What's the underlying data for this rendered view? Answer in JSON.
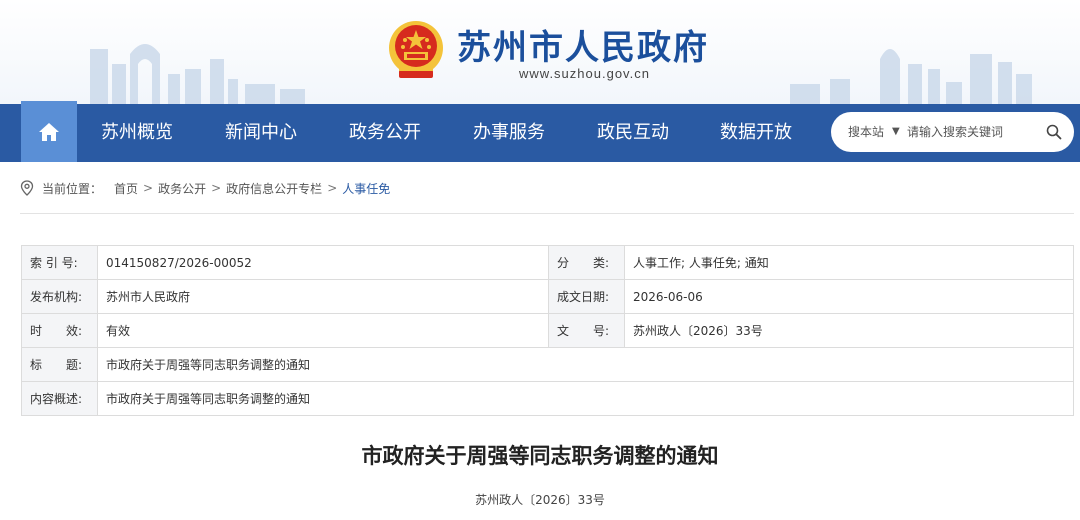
{
  "header": {
    "site_title": "苏州市人民政府",
    "site_url": "www.suzhou.gov.cn"
  },
  "nav": {
    "home_icon": "home-icon",
    "items": [
      {
        "label": "苏州概览"
      },
      {
        "label": "新闻中心"
      },
      {
        "label": "政务公开"
      },
      {
        "label": "办事服务"
      },
      {
        "label": "政民互动"
      },
      {
        "label": "数据开放"
      }
    ],
    "search": {
      "scope": "搜本站",
      "placeholder": "请输入搜索关键词"
    }
  },
  "breadcrumb": {
    "label": "当前位置：",
    "items": [
      "首页",
      "政务公开",
      "政府信息公开专栏",
      "人事任免"
    ],
    "separator": ">"
  },
  "info": {
    "index_label": "索 引 号:",
    "index_value": "014150827/2026-00052",
    "category_label": "分　　类:",
    "category_value": "人事工作;  人事任免;  通知",
    "publisher_label": "发布机构:",
    "publisher_value": "苏州市人民政府",
    "date_label": "成文日期:",
    "date_value": "2026-06-06",
    "validity_label": "时　　效:",
    "validity_value": "有效",
    "docno_label": "文　　号:",
    "docno_value": "苏州政人〔2026〕33号",
    "title_label": "标　　题:",
    "title_value": "市政府关于周强等同志职务调整的通知",
    "summary_label": "内容概述:",
    "summary_value": "市政府关于周强等同志职务调整的通知"
  },
  "article": {
    "title": "市政府关于周强等同志职务调整的通知",
    "doc_number": "苏州政人〔2026〕33号"
  },
  "colors": {
    "nav_bg": "#2a5aa3",
    "home_bg": "#5a8fd6",
    "title_blue": "#1b4f9c"
  }
}
